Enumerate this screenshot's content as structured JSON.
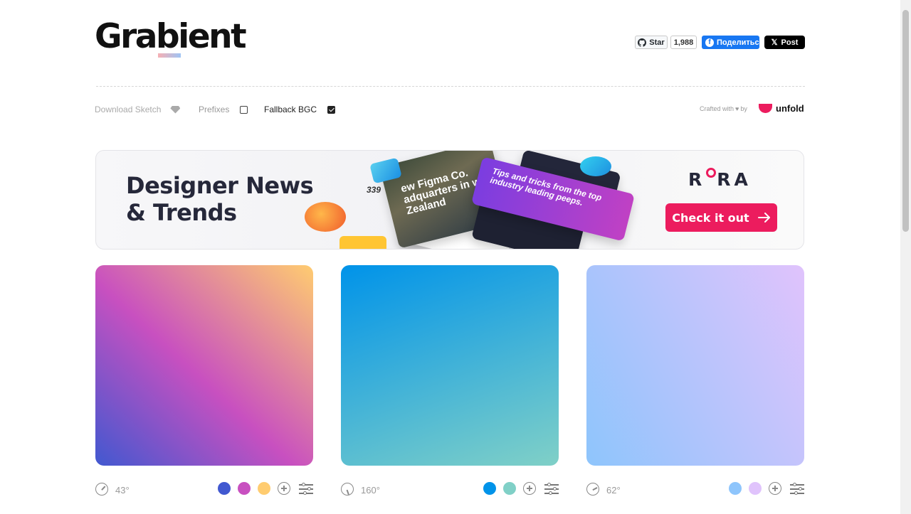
{
  "header": {
    "logo": "Grabient",
    "social": {
      "github_star": "Star",
      "github_count": "1,988",
      "facebook_share": "Поделитьс",
      "x_post": "Post"
    }
  },
  "toolbar": {
    "download_sketch": "Download Sketch",
    "prefixes": "Prefixes",
    "prefixes_checked": false,
    "fallback_bgc": "Fallback BGC",
    "fallback_checked": true,
    "crafted_with": "Crafted with",
    "by": "by",
    "unfold": "unfold"
  },
  "banner": {
    "title_line1": "Designer News",
    "title_line2": "& Trends",
    "count": "339",
    "photo_text": "ew Figma Co. adquarters in w Zealand",
    "card_text": "Tips and tricks from the top industry leading peeps.",
    "brand_r": "R",
    "brand_ra": "RA",
    "cta_label": "Check it out"
  },
  "gradients": [
    {
      "angle": "43°",
      "colors": [
        "#4158D0",
        "#C850C0",
        "#FFCC70"
      ]
    },
    {
      "angle": "160°",
      "colors": [
        "#0093E9",
        "#80D0C7"
      ]
    },
    {
      "angle": "62°",
      "colors": [
        "#8EC5FC",
        "#E0C3FC"
      ]
    }
  ],
  "colors": {
    "accent": "#EC1C5E",
    "facebook": "#1877F2",
    "banner_title": "#26283A"
  }
}
